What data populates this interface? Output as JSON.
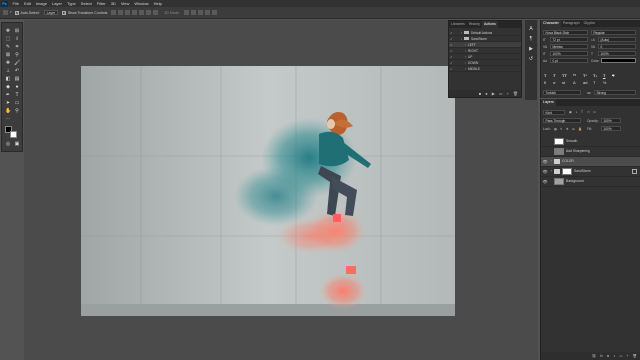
{
  "menubar": {
    "logo": "Ps",
    "items": [
      "File",
      "Edit",
      "Image",
      "Layer",
      "Type",
      "Select",
      "Filter",
      "3D",
      "View",
      "Window",
      "Help"
    ]
  },
  "options_bar": {
    "auto_select_label": "Auto-Select:",
    "auto_select_target": "Layer",
    "transform_controls_label": "Show Transform Controls",
    "mode_3d_label": "3D Mode:"
  },
  "toolbar": {
    "tools": [
      "move",
      "artboard",
      "marquee",
      "lasso",
      "quick-select",
      "crop",
      "frame",
      "eyedropper",
      "healing",
      "brush",
      "clone",
      "history",
      "eraser",
      "gradient",
      "blur",
      "dodge",
      "pen",
      "type",
      "path-select",
      "shape",
      "hand",
      "zoom",
      "more"
    ]
  },
  "actions_panel": {
    "tabs": [
      "Libraries",
      "History",
      "Actions"
    ],
    "active_tab": "Actions",
    "rows": [
      {
        "label": "Default Actions",
        "checked": true,
        "kind": "set",
        "expanded": false
      },
      {
        "label": "SandStorm",
        "checked": true,
        "kind": "set",
        "expanded": true
      },
      {
        "label": "LEFT",
        "checked": true,
        "kind": "action",
        "selected": true
      },
      {
        "label": "RIGHT",
        "checked": true,
        "kind": "action"
      },
      {
        "label": "UP",
        "checked": true,
        "kind": "action"
      },
      {
        "label": "DOWN",
        "checked": true,
        "kind": "action"
      },
      {
        "label": "MIDDLE",
        "checked": true,
        "kind": "action"
      }
    ]
  },
  "character_panel": {
    "tabs": [
      "Character",
      "Paragraph",
      "Glyphs"
    ],
    "active_tab": "Character",
    "font_family": "Nova Black Shdr",
    "font_style": "Regular",
    "font_size": "72 pt",
    "leading": "(Auto)",
    "kerning": "Metrics",
    "tracking": "0",
    "vertical_scale": "100%",
    "horizontal_scale": "100%",
    "baseline_shift": "0 pt",
    "color_label": "Color:",
    "color_hex": "#000000",
    "language": "Turkish",
    "anti_alias": "Strong"
  },
  "layers_panel": {
    "tab": "Layers",
    "filter_kind": "Kind",
    "blend_mode": "Pass Through",
    "opacity_label": "Opacity:",
    "opacity": "100%",
    "lock_label": "Lock:",
    "fill_label": "Fill:",
    "fill": "100%",
    "layers": [
      {
        "name": "Smooth",
        "visible": false,
        "kind": "layer"
      },
      {
        "name": "Add Sharpening",
        "visible": false,
        "kind": "layer"
      },
      {
        "name": "COLOR",
        "visible": true,
        "kind": "group",
        "selected": true
      },
      {
        "name": "SandStorm",
        "visible": true,
        "kind": "group"
      },
      {
        "name": "Background",
        "visible": true,
        "kind": "image"
      }
    ]
  },
  "colors": {
    "app_bg": "#535353",
    "panel_bg": "#323232",
    "selection": "#4c4c4c",
    "accent_teal": "#1f7b82",
    "accent_coral": "#ee6f5f"
  }
}
